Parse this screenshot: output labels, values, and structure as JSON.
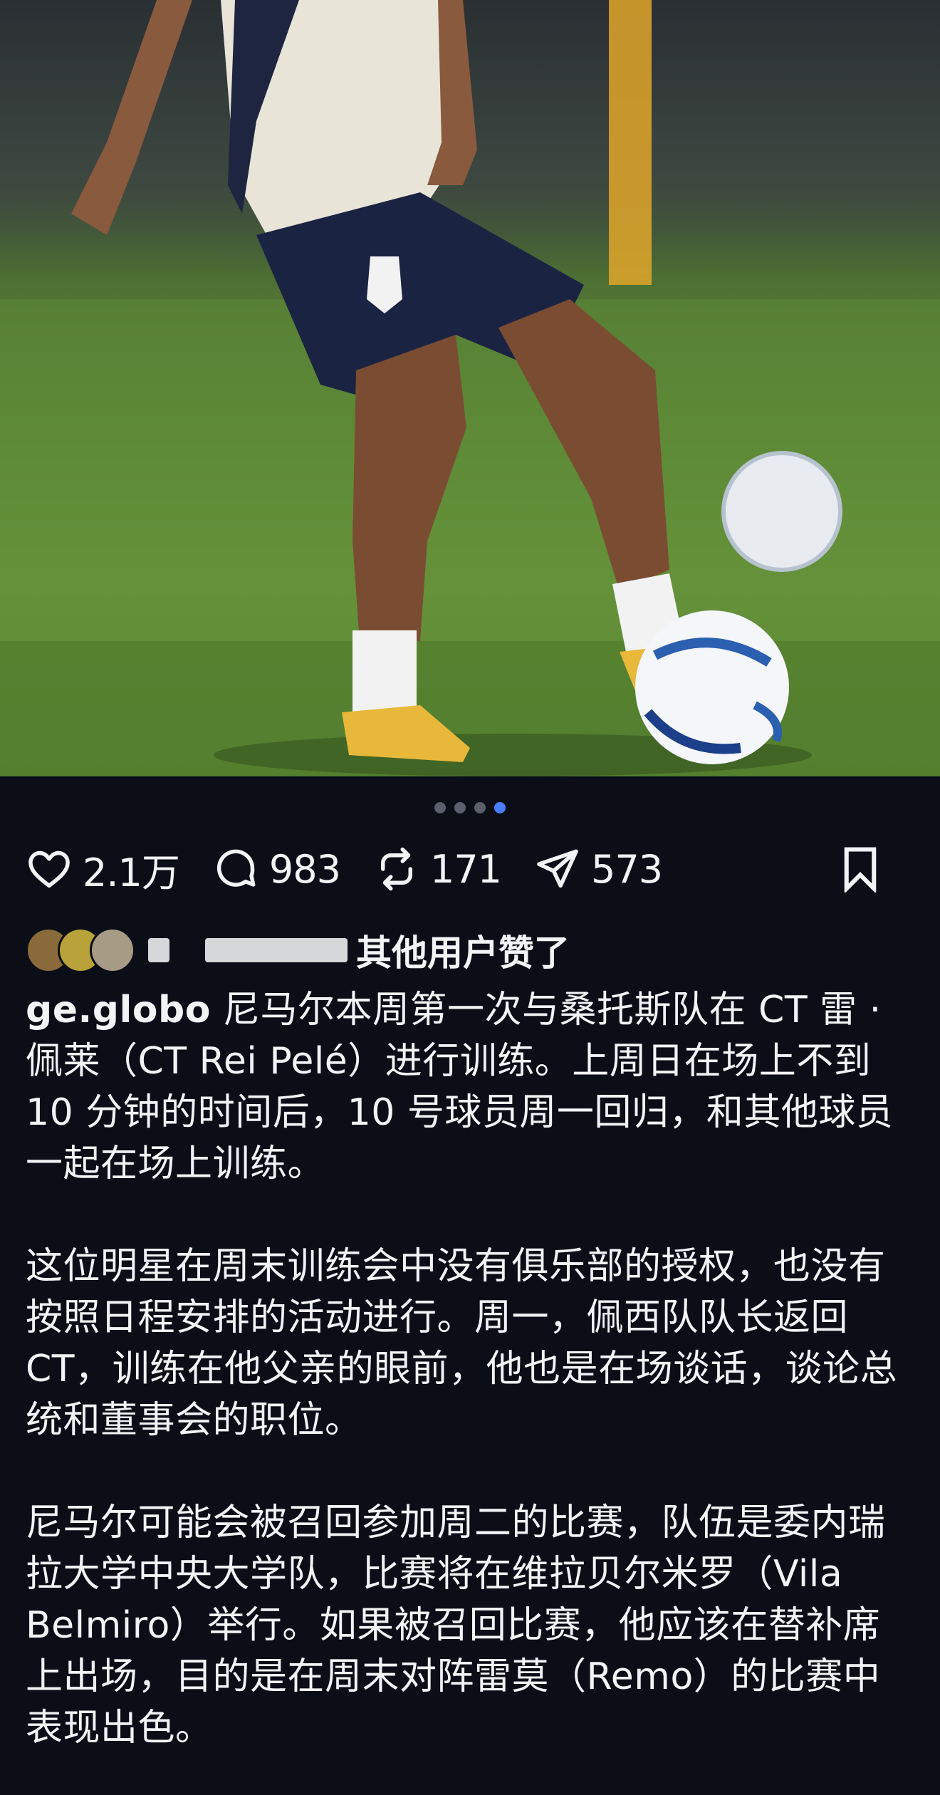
{
  "post": {
    "image_alt": "photo",
    "carousel": {
      "count": 4,
      "active_index": 4
    }
  },
  "actions": {
    "likes": "2.1万",
    "comments": "983",
    "reposts": "171",
    "shares": "573"
  },
  "liked_by": {
    "text_suffix": "其他用户赞了"
  },
  "caption": {
    "username": "ge.globo",
    "paragraph_1": " 尼马尔本周第一次与桑托斯队在 CT 雷 · 佩莱（CT Rei Pelé）进行训练。上周日在场上不到 10 分钟的时间后，10 号球员周一回归，和其他球员一起在场上训练。",
    "paragraph_2": "这位明星在周末训练会中没有俱乐部的授权，也没有按照日程安排的活动进行。周一，佩西队队长返回 CT，训练在他父亲的眼前，他也是在场谈话，谈论总统和董事会的职位。",
    "paragraph_3": "尼马尔可能会被召回参加周二的比赛，队伍是委内瑞拉大学中央大学队，比赛将在维拉贝尔米罗（Vila Belmiro）举行。如果被召回比赛，他应该在替补席上出场，目的是在周末对阵雷莫（Remo）的比赛中表现出色。"
  },
  "colors": {
    "background": "#0b0e17",
    "text": "#f2f3f5",
    "carousel_active": "#4a7dff",
    "carousel_inactive": "#5b5f6b"
  },
  "icons": [
    "heart-icon",
    "comment-icon",
    "repost-icon",
    "share-icon",
    "bookmark-icon"
  ]
}
